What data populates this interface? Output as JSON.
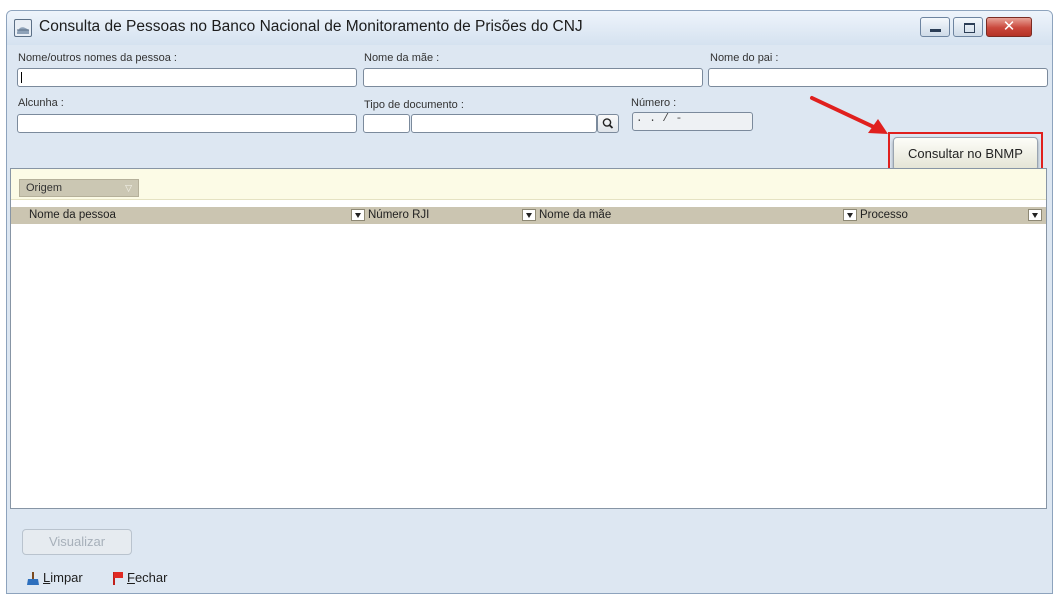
{
  "window": {
    "title": "Consulta de Pessoas no Banco Nacional de Monitoramento de Prisões do CNJ",
    "controls": {
      "minimize": "minimize-icon",
      "maximize": "maximize-icon",
      "close": "close-icon"
    }
  },
  "form": {
    "nome_label": "Nome/outros nomes da pessoa :",
    "nome_value": "",
    "mae_label": "Nome da mãe :",
    "mae_value": "",
    "pai_label": "Nome do pai :",
    "pai_value": "",
    "alcunha_label": "Alcunha :",
    "alcunha_value": "",
    "tipo_doc_label": "Tipo de documento :",
    "tipo_doc_code": "",
    "tipo_doc_desc": "",
    "numero_label": "Número :",
    "numero_value": " . . /  -",
    "submit_label": "Consultar no BNMP"
  },
  "results": {
    "group_chip": "Origem",
    "columns": [
      "Nome da pessoa",
      "Número RJI",
      "Nome da mãe",
      "Processo"
    ],
    "rows": []
  },
  "actions": {
    "visualizar_label": "Visualizar",
    "limpar_accesskey": "L",
    "limpar_rest": "impar",
    "fechar_accesskey": "F",
    "fechar_rest": "echar"
  },
  "colors": {
    "highlight": "#e0201e",
    "arrow": "#e0201e",
    "group_bar": "#fcfbe6",
    "header": "#cbc5b1"
  }
}
